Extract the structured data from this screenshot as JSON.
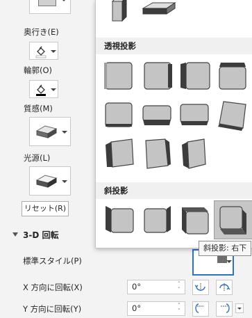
{
  "pane": {
    "depth_label": "奥行き(E)",
    "contour_label": "輪郭(O)",
    "material_label": "質感(M)",
    "lighting_label": "光源(L)",
    "reset_button": "リセット(R)",
    "rotation_section_title": "3-D 回転",
    "presets_label": "標準スタイル(P)",
    "x_rotation_label": "X 方向に回転(X)",
    "x_rotation_value": "0°",
    "y_rotation_label": "Y 方向に回転(Y)",
    "y_rotation_value": "0°"
  },
  "gallery": {
    "perspective_header": "透視投影",
    "oblique_header": "斜投影",
    "tooltip": "斜投影: 右下",
    "selected_preset": "斜投影: 右下"
  },
  "colors": {
    "accent_blue": "#2b73c7",
    "tile_fill": "#c4c4c4",
    "tile_dark": "#3c3c3c",
    "selected_bg": "#c6c6c6"
  }
}
